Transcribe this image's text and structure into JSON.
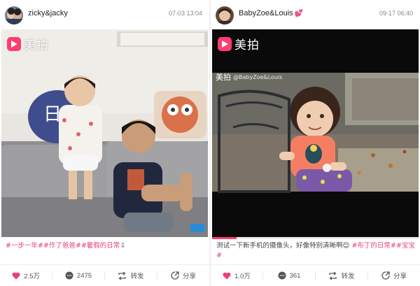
{
  "posts": [
    {
      "username": "zicky&jacky",
      "timestamp": "07-03 13:04",
      "watermark": "美拍",
      "progress": 0.0,
      "caption_parts": [
        {
          "text": "#一步一年##作了爸爸##暑假的日常",
          "tag": true
        },
        {
          "text": "⇩",
          "tag": false
        }
      ],
      "actions": {
        "like_count": "2.5万",
        "comment_count": "2475",
        "repost_label": "转发",
        "share_label": "分享"
      },
      "colors": {
        "accent": "#e8407a"
      }
    },
    {
      "username": "BabyZoe&Louis",
      "username_badge": "💕",
      "timestamp": "09-17 06:40",
      "watermark": "美拍",
      "watermark_small_brand": "美拍",
      "watermark_small_user": "@BabyZoe&Louis",
      "progress": 0.12,
      "caption_parts": [
        {
          "text": "测试一下新手机的摄像头，好像特别清晰啊",
          "tag": false
        },
        {
          "text": "😊",
          "tag": false
        },
        {
          "text": " #布丁的日常##宝宝#",
          "tag": true
        }
      ],
      "actions": {
        "like_count": "1.0万",
        "comment_count": "361",
        "repost_label": "转发",
        "share_label": "分享"
      },
      "colors": {
        "accent": "#e8407a"
      }
    }
  ]
}
